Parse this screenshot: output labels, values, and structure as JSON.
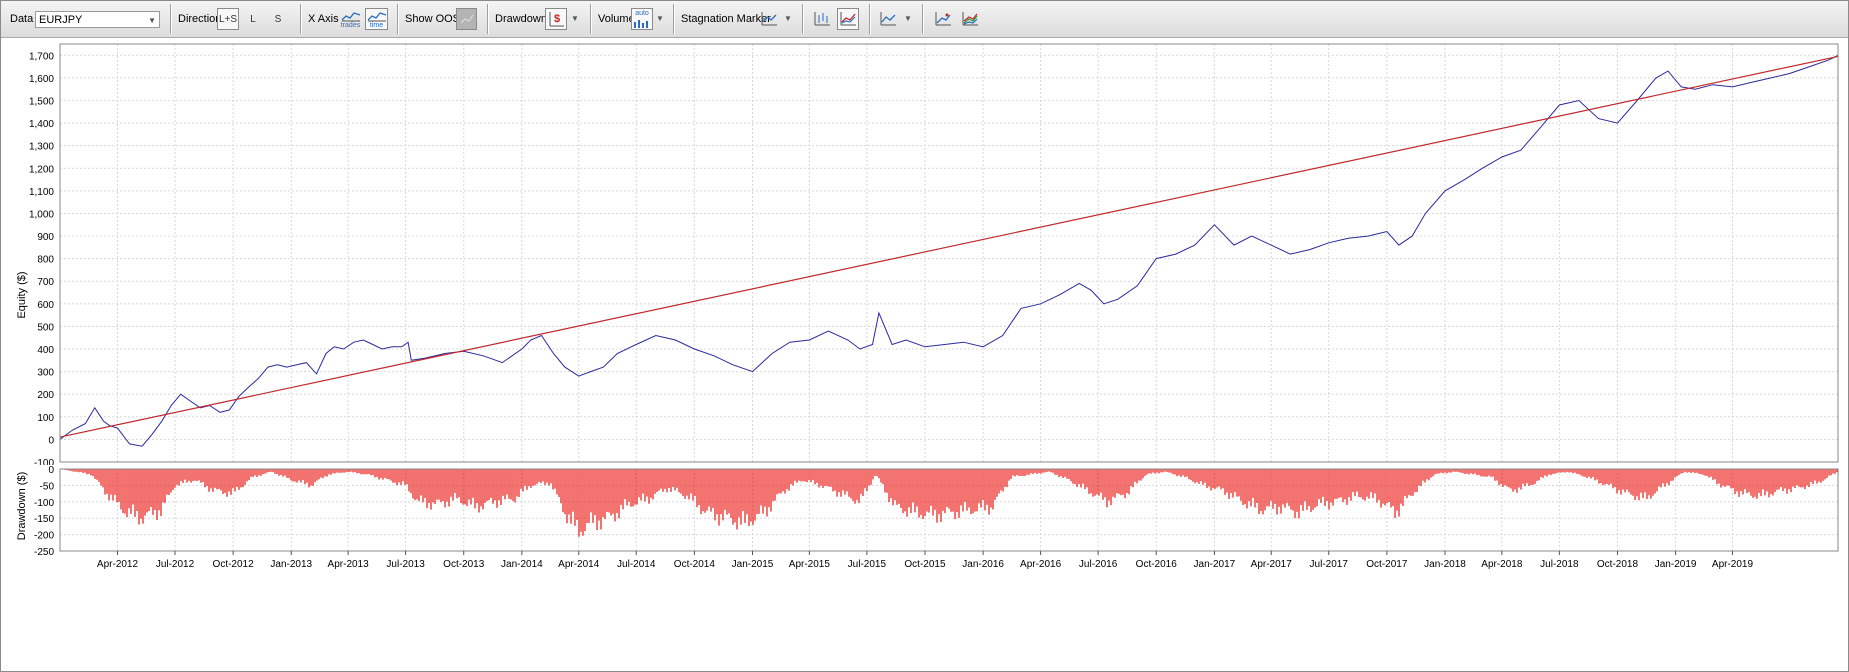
{
  "toolbar": {
    "data_label": "Data",
    "data_value": "EURJPY",
    "direction_label": "Direction",
    "direction_options": [
      "L+S",
      "L",
      "S"
    ],
    "xaxis_label": "X Axis",
    "xaxis_trades_label": "trades",
    "xaxis_time_label": "time",
    "show_oos_label": "Show OOS",
    "drawdown_label": "Drawdown",
    "drawdown_icon_text": "$",
    "volume_label": "Volume",
    "volume_icon_text": "auto",
    "stagnation_label": "Stagnation Marker"
  },
  "colors": {
    "equity_line": "#2a2a9a",
    "trend_line": "#c0282d",
    "drawdown_fill": "#e8150f",
    "grid": "#d8d8d8"
  },
  "chart_data": [
    {
      "type": "line",
      "ylabel": "Equity ($)",
      "ylim": [
        -100,
        1750
      ],
      "yticks": [
        -100,
        0,
        100,
        200,
        300,
        400,
        500,
        600,
        700,
        800,
        900,
        1000,
        1100,
        1200,
        1300,
        1400,
        1500,
        1600,
        1700
      ],
      "ytick_labels": [
        "-100",
        "0",
        "100",
        "200",
        "300",
        "400",
        "500",
        "600",
        "700",
        "800",
        "900",
        "1,000",
        "1,100",
        "1,200",
        "1,300",
        "1,400",
        "1,500",
        "1,600",
        "1,700"
      ],
      "x_start": "2012-01-01",
      "x_end": "2019-09-15",
      "xticks": [
        "2012-04-01",
        "2012-07-01",
        "2012-10-01",
        "2013-01-01",
        "2013-04-01",
        "2013-07-01",
        "2013-10-01",
        "2014-01-01",
        "2014-04-01",
        "2014-07-01",
        "2014-10-01",
        "2015-01-01",
        "2015-04-01",
        "2015-07-01",
        "2015-10-01",
        "2016-01-01",
        "2016-04-01",
        "2016-07-01",
        "2016-10-01",
        "2017-01-01",
        "2017-04-01",
        "2017-07-01",
        "2017-10-01",
        "2018-01-01",
        "2018-04-01",
        "2018-07-01",
        "2018-10-01",
        "2019-01-01",
        "2019-04-01"
      ],
      "xtick_labels": [
        "Apr-2012",
        "Jul-2012",
        "Oct-2012",
        "Jan-2013",
        "Apr-2013",
        "Jul-2013",
        "Oct-2013",
        "Jan-2014",
        "Apr-2014",
        "Jul-2014",
        "Oct-2014",
        "Jan-2015",
        "Apr-2015",
        "Jul-2015",
        "Oct-2015",
        "Jan-2016",
        "Apr-2016",
        "Jul-2016",
        "Oct-2016",
        "Jan-2017",
        "Apr-2017",
        "Jul-2017",
        "Oct-2017",
        "Jan-2018",
        "Apr-2018",
        "Jul-2018",
        "Oct-2018",
        "Jan-2019",
        "Apr-2019"
      ],
      "grid": true,
      "series": [
        {
          "style": "equity",
          "x": [
            "2012-01-01",
            "2012-01-20",
            "2012-02-10",
            "2012-02-25",
            "2012-03-10",
            "2012-03-20",
            "2012-04-01",
            "2012-04-20",
            "2012-05-10",
            "2012-05-25",
            "2012-06-10",
            "2012-06-25",
            "2012-07-10",
            "2012-07-25",
            "2012-08-10",
            "2012-08-25",
            "2012-09-10",
            "2012-09-25",
            "2012-10-10",
            "2012-10-25",
            "2012-11-10",
            "2012-11-25",
            "2012-12-10",
            "2012-12-25",
            "2013-01-10",
            "2013-01-25",
            "2013-02-10",
            "2013-02-25",
            "2013-03-10",
            "2013-03-25",
            "2013-04-10",
            "2013-04-25",
            "2013-05-10",
            "2013-05-25",
            "2013-06-10",
            "2013-06-25",
            "2013-07-05",
            "2013-07-10",
            "2013-08-01",
            "2013-09-01",
            "2013-10-01",
            "2013-11-01",
            "2013-12-01",
            "2014-01-01",
            "2014-01-15",
            "2014-02-01",
            "2014-02-20",
            "2014-03-10",
            "2014-04-01",
            "2014-04-20",
            "2014-05-10",
            "2014-06-01",
            "2014-07-01",
            "2014-08-01",
            "2014-09-01",
            "2014-10-01",
            "2014-11-01",
            "2014-12-01",
            "2015-01-01",
            "2015-02-01",
            "2015-03-01",
            "2015-04-01",
            "2015-05-01",
            "2015-06-01",
            "2015-06-20",
            "2015-07-10",
            "2015-07-20",
            "2015-08-10",
            "2015-09-01",
            "2015-10-01",
            "2015-11-01",
            "2015-12-01",
            "2016-01-01",
            "2016-02-01",
            "2016-03-01",
            "2016-04-01",
            "2016-05-01",
            "2016-06-01",
            "2016-06-20",
            "2016-07-10",
            "2016-08-01",
            "2016-09-01",
            "2016-10-01",
            "2016-11-01",
            "2016-12-01",
            "2017-01-01",
            "2017-02-01",
            "2017-03-01",
            "2017-04-01",
            "2017-05-01",
            "2017-06-01",
            "2017-07-01",
            "2017-08-01",
            "2017-09-01",
            "2017-10-01",
            "2017-10-20",
            "2017-11-10",
            "2017-12-01",
            "2018-01-01",
            "2018-02-01",
            "2018-03-01",
            "2018-04-01",
            "2018-05-01",
            "2018-06-01",
            "2018-07-01",
            "2018-08-01",
            "2018-09-01",
            "2018-10-01",
            "2018-11-01",
            "2018-12-01",
            "2018-12-20",
            "2019-01-10",
            "2019-02-01",
            "2019-03-01",
            "2019-04-01",
            "2019-05-01",
            "2019-06-01",
            "2019-07-01",
            "2019-08-01",
            "2019-09-01",
            "2019-09-15"
          ],
          "y": [
            0,
            40,
            70,
            140,
            80,
            60,
            50,
            -20,
            -30,
            20,
            80,
            150,
            200,
            170,
            140,
            150,
            120,
            130,
            190,
            230,
            270,
            320,
            330,
            320,
            330,
            340,
            290,
            380,
            410,
            400,
            430,
            440,
            420,
            400,
            410,
            410,
            430,
            350,
            360,
            380,
            390,
            370,
            340,
            400,
            440,
            460,
            380,
            320,
            280,
            300,
            320,
            380,
            420,
            460,
            440,
            400,
            370,
            330,
            300,
            380,
            430,
            440,
            480,
            440,
            400,
            420,
            560,
            420,
            440,
            410,
            420,
            430,
            410,
            460,
            580,
            600,
            640,
            690,
            660,
            600,
            620,
            680,
            800,
            820,
            860,
            950,
            860,
            900,
            860,
            820,
            840,
            870,
            890,
            900,
            920,
            860,
            900,
            1000,
            1100,
            1150,
            1200,
            1250,
            1280,
            1380,
            1480,
            1500,
            1420,
            1400,
            1500,
            1600,
            1630,
            1560,
            1550,
            1570,
            1560,
            1580,
            1600,
            1620,
            1650,
            1680,
            1700
          ]
        },
        {
          "style": "trend",
          "x": [
            "2012-01-01",
            "2019-09-15"
          ],
          "y": [
            10,
            1695
          ]
        }
      ]
    },
    {
      "type": "area",
      "ylabel": "Drawdown ($)",
      "ylim": [
        -250,
        0
      ],
      "yticks": [
        0,
        -50,
        -100,
        -150,
        -200,
        -250
      ],
      "ytick_labels": [
        "0",
        "-50",
        "-100",
        "-150",
        "-200",
        "-250"
      ],
      "grid": true,
      "fill": "red",
      "x": [
        "2012-01-01",
        "2012-02-20",
        "2012-03-15",
        "2012-04-15",
        "2012-05-10",
        "2012-06-10",
        "2012-07-01",
        "2012-08-01",
        "2012-09-01",
        "2012-10-01",
        "2012-11-01",
        "2012-12-01",
        "2013-01-01",
        "2013-02-01",
        "2013-03-01",
        "2013-04-01",
        "2013-05-01",
        "2013-06-01",
        "2013-07-01",
        "2013-07-20",
        "2013-08-20",
        "2013-09-20",
        "2013-10-20",
        "2013-11-20",
        "2013-12-20",
        "2014-01-15",
        "2014-02-15",
        "2014-03-10",
        "2014-04-01",
        "2014-04-20",
        "2014-05-20",
        "2014-06-20",
        "2014-07-20",
        "2014-08-20",
        "2014-09-20",
        "2014-10-20",
        "2014-11-20",
        "2014-12-20",
        "2015-01-20",
        "2015-02-20",
        "2015-03-20",
        "2015-04-20",
        "2015-05-20",
        "2015-06-20",
        "2015-07-15",
        "2015-08-15",
        "2015-09-15",
        "2015-10-15",
        "2015-11-15",
        "2015-12-15",
        "2016-01-15",
        "2016-02-15",
        "2016-03-15",
        "2016-04-15",
        "2016-05-15",
        "2016-06-15",
        "2016-07-15",
        "2016-08-15",
        "2016-09-15",
        "2016-10-15",
        "2016-11-15",
        "2016-12-15",
        "2017-01-15",
        "2017-02-15",
        "2017-03-15",
        "2017-04-15",
        "2017-05-15",
        "2017-06-15",
        "2017-07-15",
        "2017-08-15",
        "2017-09-15",
        "2017-10-15",
        "2017-11-15",
        "2017-12-15",
        "2018-01-15",
        "2018-02-15",
        "2018-03-15",
        "2018-04-15",
        "2018-05-15",
        "2018-06-15",
        "2018-07-15",
        "2018-08-15",
        "2018-09-15",
        "2018-10-15",
        "2018-11-15",
        "2018-12-15",
        "2019-01-15",
        "2019-02-15",
        "2019-03-15",
        "2019-04-15",
        "2019-05-15",
        "2019-06-15",
        "2019-07-15",
        "2019-08-15",
        "2019-09-15"
      ],
      "values": [
        0,
        -20,
        -90,
        -160,
        -180,
        -150,
        -60,
        -40,
        -80,
        -90,
        -30,
        -10,
        -40,
        -60,
        -20,
        -10,
        -20,
        -40,
        -60,
        -120,
        -130,
        -110,
        -140,
        -120,
        -110,
        -60,
        -50,
        -160,
        -230,
        -200,
        -180,
        -130,
        -110,
        -70,
        -100,
        -160,
        -180,
        -200,
        -160,
        -80,
        -40,
        -60,
        -90,
        -120,
        -20,
        -140,
        -160,
        -170,
        -160,
        -150,
        -140,
        -30,
        -20,
        -10,
        -40,
        -80,
        -120,
        -90,
        -20,
        -10,
        -30,
        -60,
        -80,
        -120,
        -150,
        -140,
        -160,
        -130,
        -120,
        -100,
        -110,
        -160,
        -80,
        -20,
        -10,
        -20,
        -30,
        -80,
        -60,
        -20,
        -10,
        -30,
        -60,
        -90,
        -110,
        -60,
        -10,
        -20,
        -60,
        -90,
        -100,
        -80,
        -70,
        -50,
        -10
      ]
    }
  ]
}
